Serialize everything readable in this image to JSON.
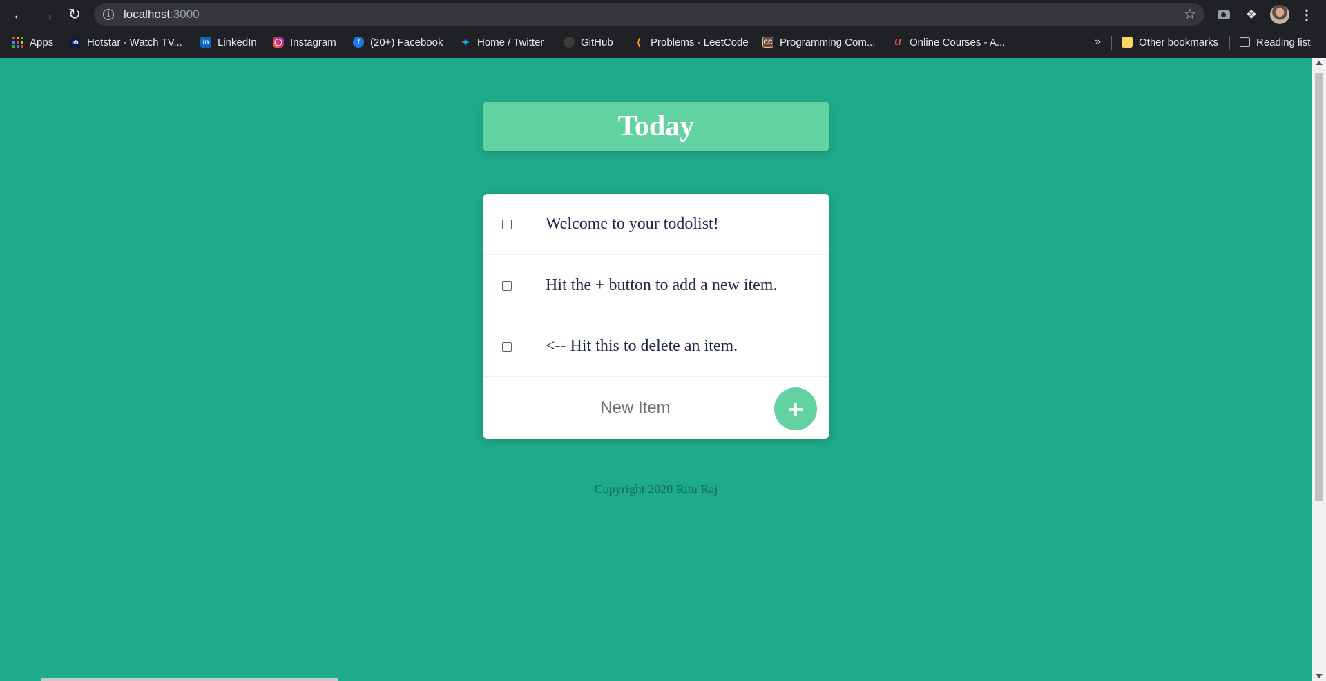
{
  "browser": {
    "url_host": "localhost",
    "url_port": ":3000",
    "icons": {
      "back": "arrow-left-icon",
      "forward": "arrow-right-icon",
      "reload": "reload-icon",
      "info": "info-icon",
      "star": "star-icon",
      "camera": "camera-icon",
      "extensions": "puzzle-icon",
      "menu": "kebab-menu-icon"
    },
    "bookmarks": [
      {
        "label": "Apps",
        "icon": "apps-grid-icon"
      },
      {
        "label": "Hotstar - Watch TV...",
        "icon": "hotstar-icon"
      },
      {
        "label": "LinkedIn",
        "icon": "linkedin-icon"
      },
      {
        "label": "Instagram",
        "icon": "instagram-icon"
      },
      {
        "label": "(20+) Facebook",
        "icon": "facebook-icon"
      },
      {
        "label": "Home / Twitter",
        "icon": "twitter-icon"
      },
      {
        "label": "GitHub",
        "icon": "github-icon"
      },
      {
        "label": "Problems - LeetCode",
        "icon": "leetcode-icon"
      },
      {
        "label": "Programming Com...",
        "icon": "codechef-icon"
      },
      {
        "label": "Online Courses - A...",
        "icon": "udemy-icon"
      }
    ],
    "overflow_label": "»",
    "other_bookmarks": "Other bookmarks",
    "reading_list": "Reading list"
  },
  "page": {
    "title": "Today",
    "items": [
      {
        "text": "Welcome to your todolist!",
        "checked": false
      },
      {
        "text": "Hit the + button to add a new item.",
        "checked": false
      },
      {
        "text": "<-- Hit this to delete an item.",
        "checked": false
      }
    ],
    "new_item_placeholder": "New Item",
    "add_button_label": "+",
    "footer": "Copyright 2020 Ritu Raj"
  },
  "colors": {
    "background": "#1faa89",
    "accent": "#62d2a2",
    "item_text": "#1e2745",
    "footer_text": "#136b55"
  }
}
